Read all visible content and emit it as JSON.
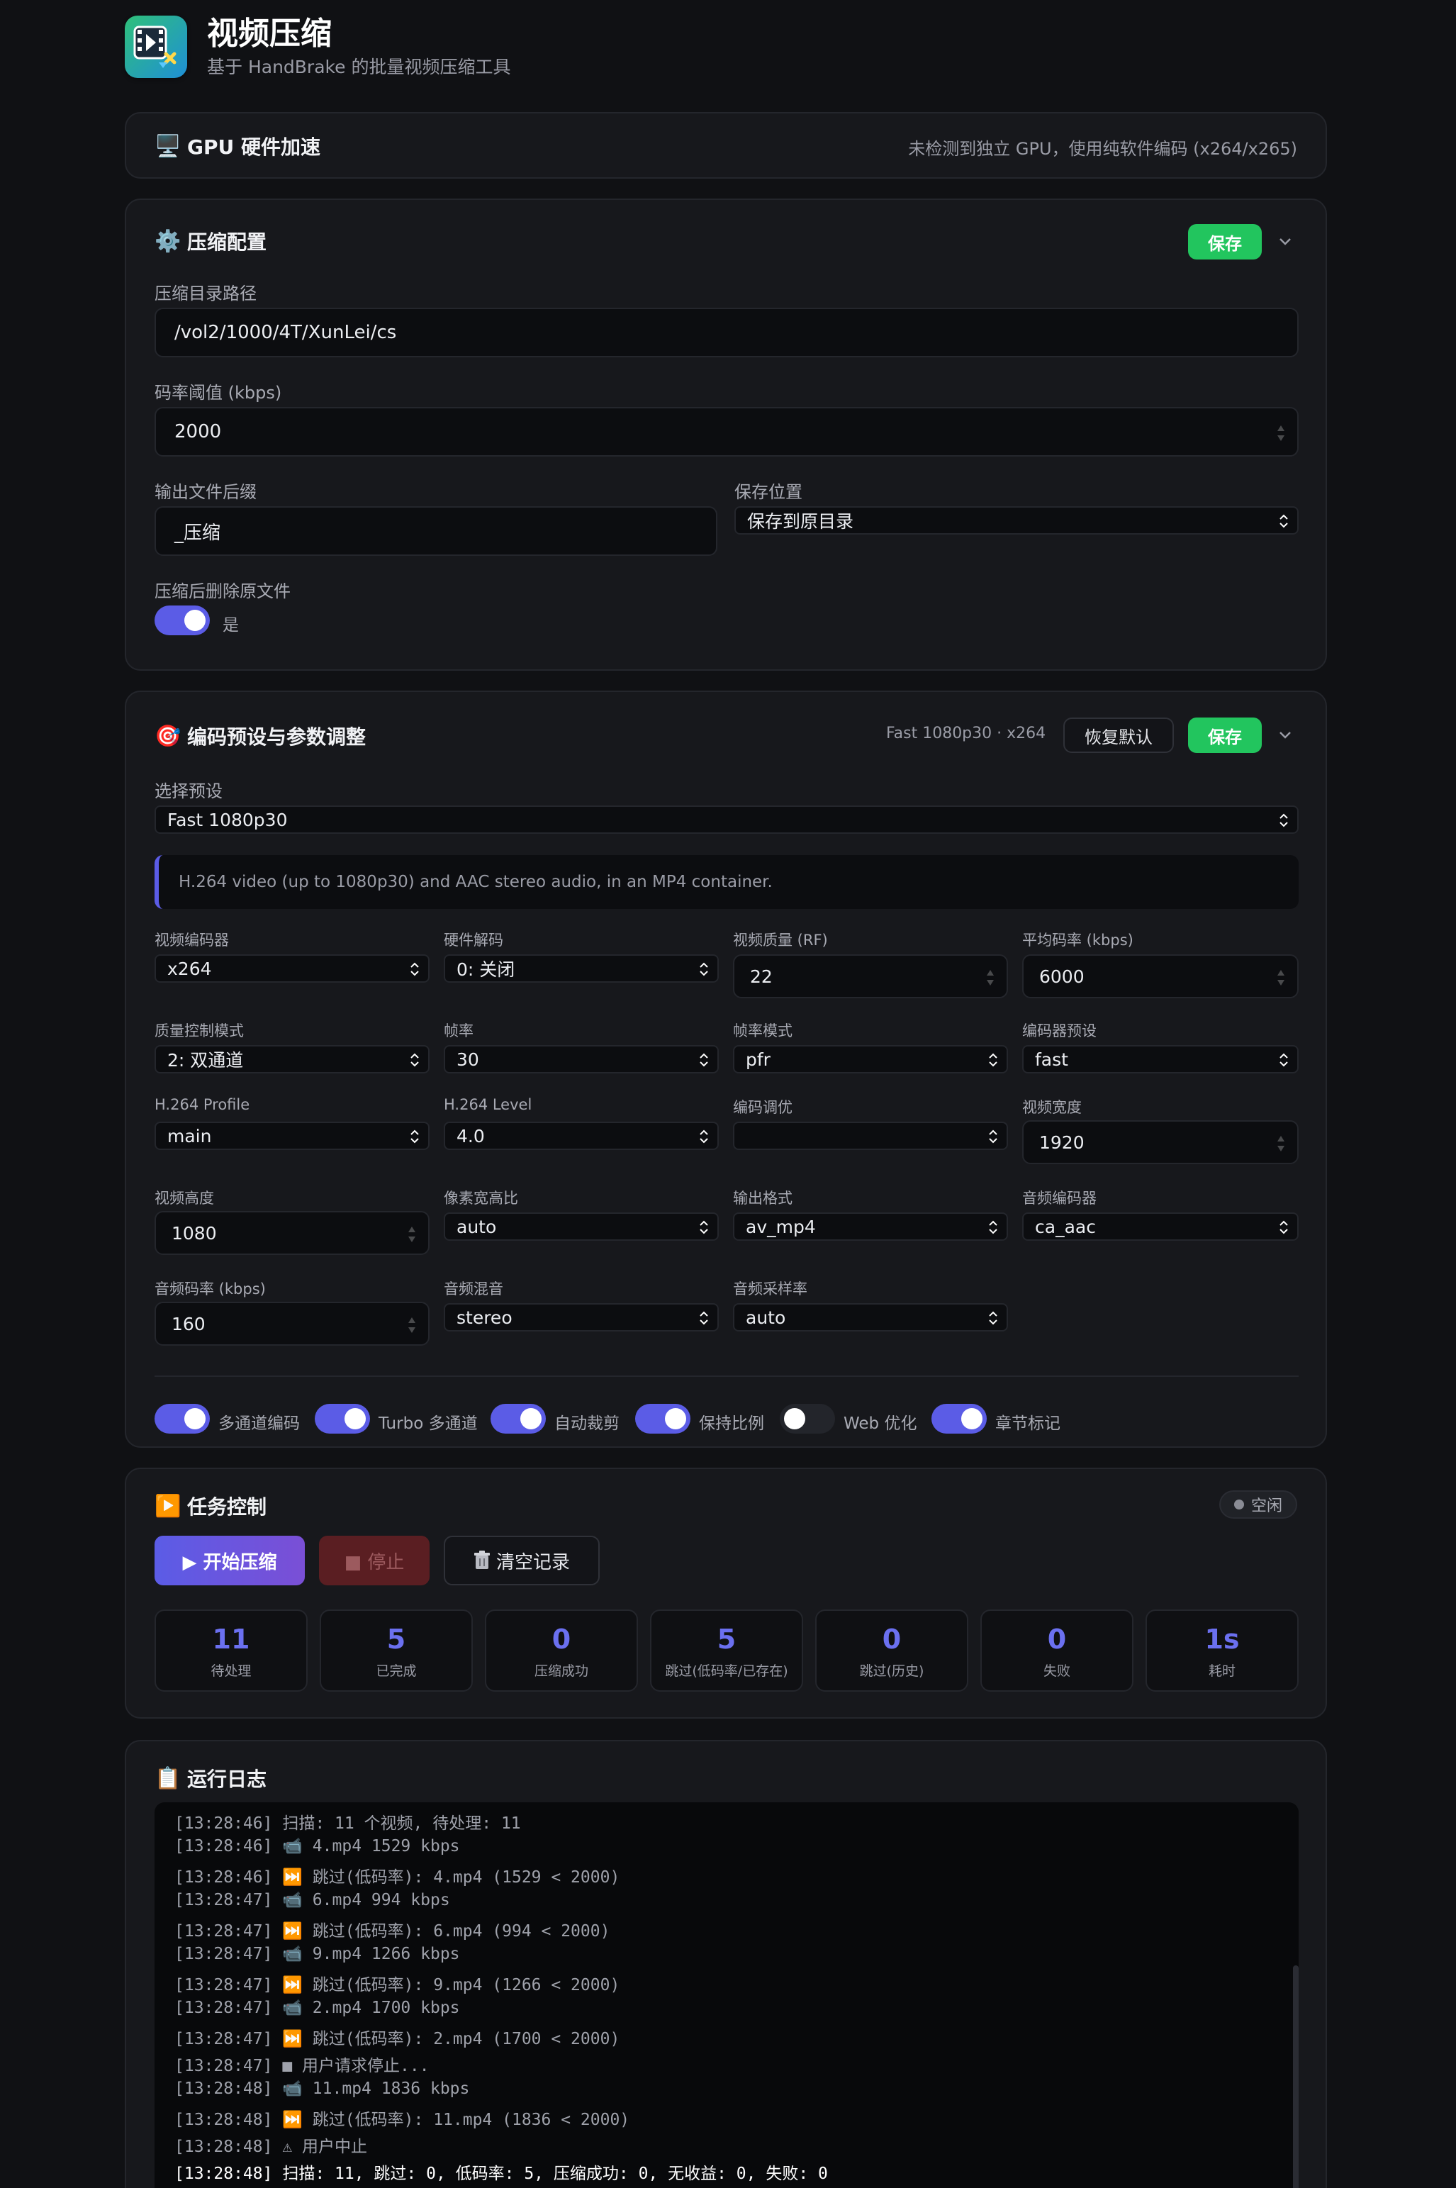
{
  "app": {
    "title": "视频压缩",
    "subtitle": "基于 HandBrake 的批量视频压缩工具"
  },
  "gpu": {
    "icon": "🖥️",
    "title": "GPU 硬件加速",
    "status": "未检测到独立 GPU，使用纯软件编码 (x264/x265)"
  },
  "config": {
    "icon": "⚙️",
    "title": "压缩配置",
    "save_label": "保存",
    "dir_label": "压缩目录路径",
    "dir_value": "/vol2/1000/4T/XunLei/cs",
    "bitrate_label": "码率阈值 (kbps)",
    "bitrate_value": "2000",
    "suffix_label": "输出文件后缀",
    "suffix_value": "_压缩",
    "location_label": "保存位置",
    "location_value": "保存到原目录",
    "delete_label": "压缩后删除原文件",
    "delete_value": "是",
    "delete_enabled": true
  },
  "preset": {
    "icon": "🎯",
    "title": "编码预设与参数调整",
    "summary": "Fast 1080p30 · x264",
    "reset_label": "恢复默认",
    "save_label": "保存",
    "select_label": "选择预设",
    "select_value": "Fast 1080p30",
    "description": "H.264 video (up to 1080p30) and AAC stereo audio, in an MP4 container.",
    "fields": {
      "video_encoder": {
        "label": "视频编码器",
        "value": "x264"
      },
      "hw_decode": {
        "label": "硬件解码",
        "value": "0: 关闭"
      },
      "quality": {
        "label": "视频质量 (RF)",
        "value": "22"
      },
      "avg_bitrate": {
        "label": "平均码率 (kbps)",
        "value": "6000"
      },
      "quality_mode": {
        "label": "质量控制模式",
        "value": "2: 双通道"
      },
      "framerate": {
        "label": "帧率",
        "value": "30"
      },
      "framerate_mode": {
        "label": "帧率模式",
        "value": "pfr"
      },
      "encoder_preset": {
        "label": "编码器预设",
        "value": "fast"
      },
      "profile": {
        "label": "H.264 Profile",
        "value": "main"
      },
      "level": {
        "label": "H.264 Level",
        "value": "4.0"
      },
      "tune": {
        "label": "编码调优",
        "value": ""
      },
      "width": {
        "label": "视频宽度",
        "value": "1920"
      },
      "height": {
        "label": "视频高度",
        "value": "1080"
      },
      "par": {
        "label": "像素宽高比",
        "value": "auto"
      },
      "format": {
        "label": "输出格式",
        "value": "av_mp4"
      },
      "audio_encoder": {
        "label": "音频编码器",
        "value": "ca_aac"
      },
      "audio_bitrate": {
        "label": "音频码率 (kbps)",
        "value": "160"
      },
      "audio_mix": {
        "label": "音频混音",
        "value": "stereo"
      },
      "audio_rate": {
        "label": "音频采样率",
        "value": "auto"
      }
    },
    "toggles": [
      {
        "label": "多通道编码",
        "on": true
      },
      {
        "label": "Turbo 多通道",
        "on": true
      },
      {
        "label": "自动裁剪",
        "on": true
      },
      {
        "label": "保持比例",
        "on": true
      },
      {
        "label": "Web 优化",
        "on": false
      },
      {
        "label": "章节标记",
        "on": true
      }
    ]
  },
  "task": {
    "icon": "▶️",
    "title": "任务控制",
    "status": "空闲",
    "start_label": "▶ 开始压缩",
    "stop_label": "■ 停止",
    "clear_label": "清空记录",
    "stats": [
      {
        "value": "11",
        "label": "待处理"
      },
      {
        "value": "5",
        "label": "已完成"
      },
      {
        "value": "0",
        "label": "压缩成功"
      },
      {
        "value": "5",
        "label": "跳过(低码率/已存在)"
      },
      {
        "value": "0",
        "label": "跳过(历史)"
      },
      {
        "value": "0",
        "label": "失败"
      },
      {
        "value": "1s",
        "label": "耗时"
      }
    ]
  },
  "log": {
    "icon": "📋",
    "title": "运行日志",
    "lines": [
      "[13:28:46] 扫描: 11 个视频, 待处理: 11",
      "[13:28:46] 📹 4.mp4 1529 kbps",
      "[13:28:46] ⏭️ 跳过(低码率): 4.mp4 (1529 < 2000)",
      "[13:28:47] 📹 6.mp4 994 kbps",
      "[13:28:47] ⏭️ 跳过(低码率): 6.mp4 (994 < 2000)",
      "[13:28:47] 📹 9.mp4 1266 kbps",
      "[13:28:47] ⏭️ 跳过(低码率): 9.mp4 (1266 < 2000)",
      "[13:28:47] 📹 2.mp4 1700 kbps",
      "[13:28:47] ⏭️ 跳过(低码率): 2.mp4 (1700 < 2000)",
      "[13:28:47] ■ 用户请求停止...",
      "[13:28:48] 📹 11.mp4 1836 kbps",
      "[13:28:48] ⏭️ 跳过(低码率): 11.mp4 (1836 < 2000)",
      "[13:28:48] ⚠ 用户中止",
      "[13:28:48] 扫描: 11, 跳过: 0, 低码率: 5, 压缩成功: 0, 无收益: 0, 失败: 0"
    ]
  },
  "colors": {
    "accent": "#5b5ce6",
    "save_green": "#22c55e",
    "stop_red": "#5a1e22",
    "stat_number": "#6b70f0"
  }
}
